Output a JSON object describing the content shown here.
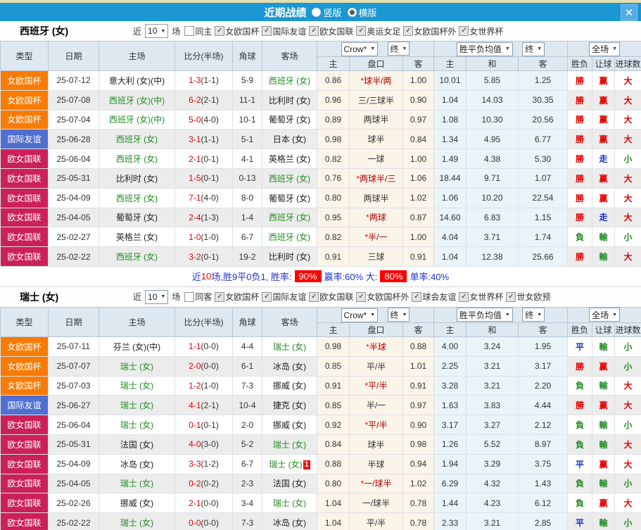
{
  "header": {
    "title": "近期战绩",
    "layout_options": [
      {
        "label": "竖版",
        "selected": false
      },
      {
        "label": "横版",
        "selected": true
      }
    ],
    "close_label": "✕"
  },
  "colors": {
    "titlebar_blue": "#1b97d4",
    "team_green": "#1f8c1f",
    "score_red": "#e80000",
    "win_red": "#e60000",
    "draw_blue": "#1133cc",
    "lose_green": "#1f8c1f",
    "summary_badge_red": "#ff0000"
  },
  "type_colors": {
    "女欧国杯": "#f87b03",
    "国际友谊": "#4f6fd0",
    "欧女国联": "#cb2058"
  },
  "result_colors": {
    "勝": "r",
    "赢": "r",
    "大": "r",
    "平": "bl",
    "走": "bl",
    "負": "g",
    "輸": "g",
    "小": "g"
  },
  "table": {
    "main_headers": [
      "类型",
      "日期",
      "主场",
      "比分(半场)",
      "角球",
      "客场"
    ],
    "sub_headers": [
      "主",
      "盘口",
      "客",
      "主",
      "和",
      "客",
      "胜负",
      "让球",
      "进球数"
    ],
    "selects": {
      "odds_source": "Crow*",
      "odds_final": "终",
      "avg": "胜平负均值",
      "avg_final": "终",
      "scope": "全场"
    }
  },
  "sections": [
    {
      "team": "西班牙 (女)",
      "filter": {
        "near_label": "近",
        "count": "10",
        "unit": "场",
        "same_label": "同主",
        "same_checked": false,
        "competitions": [
          "女欧国杯",
          "国际友谊",
          "欧女国联",
          "奥运女足",
          "女欧国杯外",
          "女世界杯"
        ]
      },
      "rows": [
        {
          "t": "女欧国杯",
          "d": "25-07-12",
          "h": "意大利 (女)(中)",
          "hg": false,
          "s": "1-3",
          "f": "(1-1)",
          "c": "5-9",
          "a": "西班牙 (女)",
          "ag": true,
          "ab": "",
          "o1": "0.86",
          "hc": "球半/两",
          "st": true,
          "o2": "1.00",
          "m1": "10.01",
          "m2": "5.85",
          "m3": "1.25",
          "r1": "勝",
          "r2": "赢",
          "r3": "大"
        },
        {
          "t": "女欧国杯",
          "d": "25-07-08",
          "h": "西班牙 (女)(中)",
          "hg": true,
          "s": "6-2",
          "f": "(2-1)",
          "c": "11-1",
          "a": "比利时 (女)",
          "ag": false,
          "ab": "",
          "o1": "0.96",
          "hc": "三/三球半",
          "st": false,
          "o2": "0.90",
          "m1": "1.04",
          "m2": "14.03",
          "m3": "30.35",
          "r1": "勝",
          "r2": "赢",
          "r3": "大"
        },
        {
          "t": "女欧国杯",
          "d": "25-07-04",
          "h": "西班牙 (女)(中)",
          "hg": true,
          "s": "5-0",
          "f": "(4-0)",
          "c": "10-1",
          "a": "葡萄牙 (女)",
          "ag": false,
          "ab": "",
          "o1": "0.89",
          "hc": "两球半",
          "st": false,
          "o2": "0.97",
          "m1": "1.08",
          "m2": "10.30",
          "m3": "20.56",
          "r1": "勝",
          "r2": "赢",
          "r3": "大"
        },
        {
          "t": "国际友谊",
          "d": "25-06-28",
          "h": "西班牙 (女)",
          "hg": true,
          "s": "3-1",
          "f": "(1-1)",
          "c": "5-1",
          "a": "日本 (女)",
          "ag": false,
          "ab": "",
          "o1": "0.98",
          "hc": "球半",
          "st": false,
          "o2": "0.84",
          "m1": "1.34",
          "m2": "4.95",
          "m3": "6.77",
          "r1": "勝",
          "r2": "赢",
          "r3": "大"
        },
        {
          "t": "欧女国联",
          "d": "25-06-04",
          "h": "西班牙 (女)",
          "hg": true,
          "s": "2-1",
          "f": "(0-1)",
          "c": "4-1",
          "a": "英格兰 (女)",
          "ag": false,
          "ab": "",
          "o1": "0.82",
          "hc": "一球",
          "st": false,
          "o2": "1.00",
          "m1": "1.49",
          "m2": "4.38",
          "m3": "5.30",
          "r1": "勝",
          "r2": "走",
          "r3": "小"
        },
        {
          "t": "欧女国联",
          "d": "25-05-31",
          "h": "比利时 (女)",
          "hg": false,
          "s": "1-5",
          "f": "(0-1)",
          "c": "0-13",
          "a": "西班牙 (女)",
          "ag": true,
          "ab": "",
          "o1": "0.76",
          "hc": "两球半/三",
          "st": true,
          "o2": "1.06",
          "m1": "18.44",
          "m2": "9.71",
          "m3": "1.07",
          "r1": "勝",
          "r2": "赢",
          "r3": "大"
        },
        {
          "t": "欧女国联",
          "d": "25-04-09",
          "h": "西班牙 (女)",
          "hg": true,
          "s": "7-1",
          "f": "(4-0)",
          "c": "8-0",
          "a": "葡萄牙 (女)",
          "ag": false,
          "ab": "",
          "o1": "0.80",
          "hc": "两球半",
          "st": false,
          "o2": "1.02",
          "m1": "1.06",
          "m2": "10.20",
          "m3": "22.54",
          "r1": "勝",
          "r2": "赢",
          "r3": "大"
        },
        {
          "t": "欧女国联",
          "d": "25-04-05",
          "h": "葡萄牙 (女)",
          "hg": false,
          "s": "2-4",
          "f": "(1-3)",
          "c": "1-4",
          "a": "西班牙 (女)",
          "ag": true,
          "ab": "",
          "o1": "0.95",
          "hc": "两球",
          "st": true,
          "o2": "0.87",
          "m1": "14.60",
          "m2": "6.83",
          "m3": "1.15",
          "r1": "勝",
          "r2": "走",
          "r3": "大"
        },
        {
          "t": "欧女国联",
          "d": "25-02-27",
          "h": "英格兰 (女)",
          "hg": false,
          "s": "1-0",
          "f": "(1-0)",
          "c": "6-7",
          "a": "西班牙 (女)",
          "ag": true,
          "ab": "",
          "o1": "0.82",
          "hc": "半/一",
          "st": true,
          "o2": "1.00",
          "m1": "4.04",
          "m2": "3.71",
          "m3": "1.74",
          "r1": "負",
          "r2": "輸",
          "r3": "小"
        },
        {
          "t": "欧女国联",
          "d": "25-02-22",
          "h": "西班牙 (女)",
          "hg": true,
          "s": "3-2",
          "f": "(0-1)",
          "c": "19-2",
          "a": "比利时 (女)",
          "ag": false,
          "ab": "",
          "o1": "0.91",
          "hc": "三球",
          "st": false,
          "o2": "0.91",
          "m1": "1.04",
          "m2": "12.38",
          "m3": "25.66",
          "r1": "勝",
          "r2": "輸",
          "r3": "大"
        }
      ],
      "summary_parts": [
        {
          "text": "近",
          "style": "b"
        },
        {
          "text": "10",
          "style": "r"
        },
        {
          "text": "场,胜9平0负1, 胜率:",
          "style": "b"
        },
        {
          "text": "90%",
          "style": "badge"
        },
        {
          "text": "赢率:60% 大:",
          "style": "b"
        },
        {
          "text": "80%",
          "style": "badge"
        },
        {
          "text": "单率:40%",
          "style": "b"
        }
      ]
    },
    {
      "team": "瑞士 (女)",
      "filter": {
        "near_label": "近",
        "count": "10",
        "unit": "场",
        "same_label": "同客",
        "same_checked": false,
        "competitions": [
          "女欧国杯",
          "国际友谊",
          "欧女国联",
          "女欧国杯外",
          "球会友谊",
          "女世界杯",
          "世女欧预"
        ]
      },
      "rows": [
        {
          "t": "女欧国杯",
          "d": "25-07-11",
          "h": "芬兰 (女)(中)",
          "hg": false,
          "s": "1-1",
          "f": "(0-0)",
          "c": "4-4",
          "a": "瑞士 (女)",
          "ag": true,
          "ab": "",
          "o1": "0.98",
          "hc": "半球",
          "st": true,
          "o2": "0.88",
          "m1": "4.00",
          "m2": "3.24",
          "m3": "1.95",
          "r1": "平",
          "r2": "輸",
          "r3": "小"
        },
        {
          "t": "女欧国杯",
          "d": "25-07-07",
          "h": "瑞士 (女)",
          "hg": true,
          "s": "2-0",
          "f": "(0-0)",
          "c": "6-1",
          "a": "冰岛 (女)",
          "ag": false,
          "ab": "",
          "o1": "0.85",
          "hc": "平/半",
          "st": false,
          "o2": "1.01",
          "m1": "2.25",
          "m2": "3.21",
          "m3": "3.17",
          "r1": "勝",
          "r2": "赢",
          "r3": "小"
        },
        {
          "t": "女欧国杯",
          "d": "25-07-03",
          "h": "瑞士 (女)",
          "hg": true,
          "s": "1-2",
          "f": "(1-0)",
          "c": "7-3",
          "a": "挪威 (女)",
          "ag": false,
          "ab": "",
          "o1": "0.91",
          "hc": "平/半",
          "st": true,
          "o2": "0.91",
          "m1": "3.28",
          "m2": "3.21",
          "m3": "2.20",
          "r1": "負",
          "r2": "輸",
          "r3": "大"
        },
        {
          "t": "国际友谊",
          "d": "25-06-27",
          "h": "瑞士 (女)",
          "hg": true,
          "s": "4-1",
          "f": "(2-1)",
          "c": "10-4",
          "a": "捷克 (女)",
          "ag": false,
          "ab": "",
          "o1": "0.85",
          "hc": "半/一",
          "st": false,
          "o2": "0.97",
          "m1": "1.63",
          "m2": "3.83",
          "m3": "4.44",
          "r1": "勝",
          "r2": "赢",
          "r3": "大"
        },
        {
          "t": "欧女国联",
          "d": "25-06-04",
          "h": "瑞士 (女)",
          "hg": true,
          "s": "0-1",
          "f": "(0-1)",
          "c": "2-0",
          "a": "挪威 (女)",
          "ag": false,
          "ab": "",
          "o1": "0.92",
          "hc": "平/半",
          "st": true,
          "o2": "0.90",
          "m1": "3.17",
          "m2": "3.27",
          "m3": "2.12",
          "r1": "負",
          "r2": "輸",
          "r3": "小"
        },
        {
          "t": "欧女国联",
          "d": "25-05-31",
          "h": "法国 (女)",
          "hg": false,
          "s": "4-0",
          "f": "(3-0)",
          "c": "5-2",
          "a": "瑞士 (女)",
          "ag": true,
          "ab": "",
          "o1": "0.84",
          "hc": "球半",
          "st": false,
          "o2": "0.98",
          "m1": "1.26",
          "m2": "5.52",
          "m3": "8.97",
          "r1": "負",
          "r2": "輸",
          "r3": "大"
        },
        {
          "t": "欧女国联",
          "d": "25-04-09",
          "h": "冰岛 (女)",
          "hg": false,
          "s": "3-3",
          "f": "(1-2)",
          "c": "6-7",
          "a": "瑞士 (女)",
          "ag": true,
          "ab": "1",
          "o1": "0.88",
          "hc": "半球",
          "st": false,
          "o2": "0.94",
          "m1": "1.94",
          "m2": "3.29",
          "m3": "3.75",
          "r1": "平",
          "r2": "赢",
          "r3": "大"
        },
        {
          "t": "欧女国联",
          "d": "25-04-05",
          "h": "瑞士 (女)",
          "hg": true,
          "s": "0-2",
          "f": "(0-2)",
          "c": "2-3",
          "a": "法国 (女)",
          "ag": false,
          "ab": "",
          "o1": "0.80",
          "hc": "一/球半",
          "st": true,
          "o2": "1.02",
          "m1": "6.29",
          "m2": "4.32",
          "m3": "1.43",
          "r1": "負",
          "r2": "輸",
          "r3": "小"
        },
        {
          "t": "欧女国联",
          "d": "25-02-26",
          "h": "挪威 (女)",
          "hg": false,
          "s": "2-1",
          "f": "(0-0)",
          "c": "3-4",
          "a": "瑞士 (女)",
          "ag": true,
          "ab": "",
          "o1": "1.04",
          "hc": "一/球半",
          "st": false,
          "o2": "0.78",
          "m1": "1.44",
          "m2": "4.23",
          "m3": "6.12",
          "r1": "負",
          "r2": "赢",
          "r3": "大"
        },
        {
          "t": "欧女国联",
          "d": "25-02-22",
          "h": "瑞士 (女)",
          "hg": true,
          "s": "0-0",
          "f": "(0-0)",
          "c": "7-3",
          "a": "冰岛 (女)",
          "ag": false,
          "ab": "",
          "o1": "1.04",
          "hc": "平/半",
          "st": false,
          "o2": "0.78",
          "m1": "2.33",
          "m2": "3.21",
          "m3": "2.85",
          "r1": "平",
          "r2": "輸",
          "r3": "小"
        }
      ]
    }
  ]
}
